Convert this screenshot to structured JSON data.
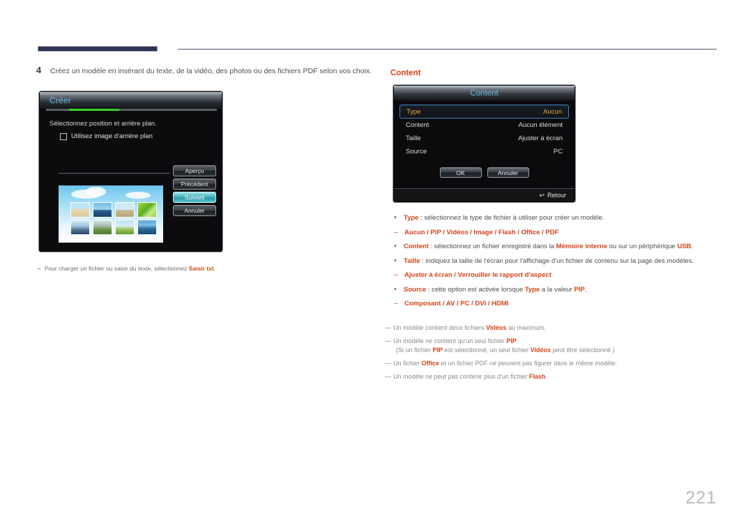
{
  "page": {
    "number": "221"
  },
  "step": {
    "number": "4",
    "text": "Créez un modèle en insérant du texte, de la vidéo, des photos ou des fichiers PDF selon vos choix."
  },
  "creer_dialog": {
    "title": "Créer",
    "instruction": "Sélectionnez position et arrière plan.",
    "checkbox_label": "Utilisez image d'arrière plan",
    "buttons": [
      {
        "label": "Aperçu",
        "selected": false
      },
      {
        "label": "Précédent",
        "selected": false
      },
      {
        "label": "Suivant",
        "selected": true
      },
      {
        "label": "Annuler",
        "selected": false
      }
    ]
  },
  "left_note": {
    "dash": "–",
    "prefix": "Pour charger un fichier ou saisir du texte, sélectionnez ",
    "bold": "Saisir txt",
    "suffix": "."
  },
  "right_heading": "Content",
  "content_dialog": {
    "title": "Content",
    "rows": [
      {
        "label": "Type",
        "value": "Aucun",
        "selected": true
      },
      {
        "label": "Content",
        "value": "Aucun élément",
        "selected": false
      },
      {
        "label": "Taille",
        "value": "Ajuster à écran",
        "selected": false
      },
      {
        "label": "Source",
        "value": "PC",
        "selected": false
      }
    ],
    "ok_label": "OK",
    "cancel_label": "Annuler",
    "return_icon": "↩",
    "return_label": "Retour"
  },
  "bullets": [
    {
      "marker": "•",
      "term": "Type",
      "body": " : sélectionnez le type de fichier à utiliser pour créer un modèle.",
      "sub_marker": "–",
      "sub": "Aucun / PIP / Vidéos / Image / Flash / Office / PDF"
    },
    {
      "marker": "•",
      "term": "Content",
      "body": " : sélectionnez un fichier enregistré dans la ",
      "body_bold": "Mémoire interne",
      "body2": " ou sur un périphérique ",
      "body_bold2": "USB",
      "body3": "."
    },
    {
      "marker": "•",
      "term": "Taille",
      "body": " : indiquez la taille de l'écran pour l'affichage d'un fichier de contenu sur la page des modèles.",
      "sub_marker": "–",
      "sub": "Ajuster à écran / Verrouiller le rapport d'aspect"
    },
    {
      "marker": "•",
      "term": "Source",
      "body": " : cette option est activée lorsque ",
      "body_bold": "Type",
      "body2": " a la valeur ",
      "body_bold2": "PIP",
      "body3": ".",
      "sub_marker": "–",
      "sub": "Composant / AV / PC / DVI / HDMI"
    }
  ],
  "notes": [
    {
      "marker": "―",
      "pre": "Un modèle contient deux fichiers ",
      "bold": "Vidéos",
      "post": " au maximum."
    },
    {
      "marker": "―",
      "pre": "Un modèle ne contient qu'un seul fichier ",
      "bold": "PIP",
      "post": ".",
      "line2_pre": "(Si un fichier ",
      "line2_bold": "PIP",
      "line2_mid": " est sélectionné, un seul fichier ",
      "line2_bold2": "Vidéos",
      "line2_post": " peut être sélectionné.)"
    },
    {
      "marker": "―",
      "pre": "Un fichier ",
      "bold": "Office",
      "post": " et un fichier PDF ne peuvent pas figurer dans le même modèle."
    },
    {
      "marker": "―",
      "pre": "Un modèle ne peut pas contenir plus d'un fichier ",
      "bold": "Flash",
      "post": "."
    }
  ],
  "colors": {
    "accent_red": "#d2431a",
    "header_navy": "#2e3252",
    "osd_blue_title": "#69bbe9",
    "osd_selected_gold": "#e9a93b",
    "progress_green": "#39d223",
    "button_selected_teal": "#4fb8c2"
  }
}
